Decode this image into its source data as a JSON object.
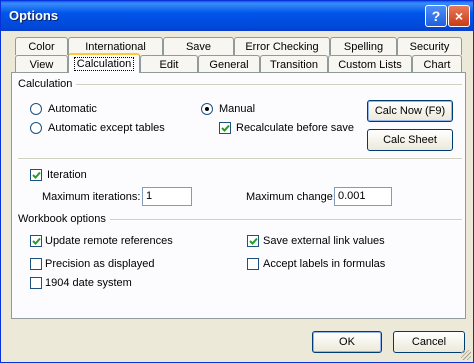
{
  "window": {
    "title": "Options"
  },
  "titlebar": {
    "help_glyph": "?",
    "close_glyph": "×"
  },
  "tabs_row1": [
    "Color",
    "International",
    "Save",
    "Error Checking",
    "Spelling",
    "Security"
  ],
  "tabs_row2": [
    "View",
    "Calculation",
    "Edit",
    "General",
    "Transition",
    "Custom Lists",
    "Chart"
  ],
  "active_tab": "Calculation",
  "calculation": {
    "section_label": "Calculation",
    "automatic": "Automatic",
    "automatic_except_tables": "Automatic except tables",
    "manual": "Manual",
    "recalculate_before_save": "Recalculate before save",
    "calc_now": "Calc Now (F9)",
    "calc_sheet": "Calc Sheet",
    "selected_mode": "Manual"
  },
  "iteration": {
    "label": "Iteration",
    "checked": true,
    "max_iterations_label": "Maximum iterations:",
    "max_iterations_value": "1",
    "max_change_label": "Maximum change:",
    "max_change_value": "0.001"
  },
  "workbook": {
    "section_label": "Workbook options",
    "update_remote_references": "Update remote references",
    "precision_as_displayed": "Precision as displayed",
    "date_system_1904": "1904 date system",
    "save_external_link_values": "Save external link values",
    "accept_labels_in_formulas": "Accept labels in formulas"
  },
  "footer": {
    "ok": "OK",
    "cancel": "Cancel"
  },
  "colors": {
    "title_blue": "#0055ea",
    "tab_highlight": "#ffc73c",
    "face": "#ece9d8"
  }
}
